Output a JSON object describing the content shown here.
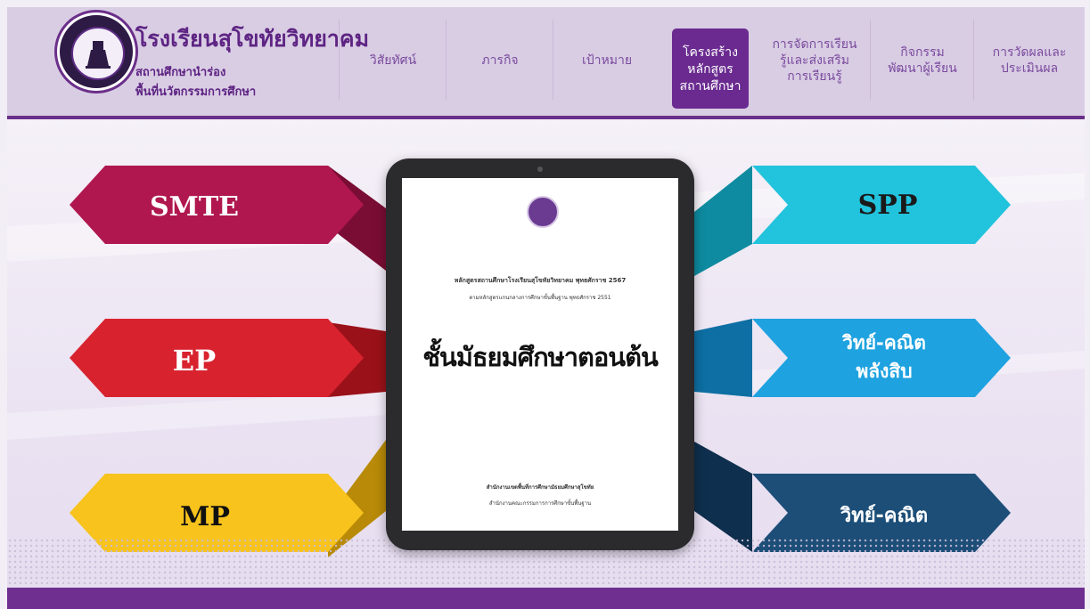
{
  "header": {
    "school_name": "โรงเรียนสุโขทัยวิทยาคม",
    "subtitle1": "สถานศึกษานำร่อง",
    "subtitle2": "พื้นที่นวัตกรรมการศึกษา"
  },
  "nav": {
    "vision": "วิสัยทัศน์",
    "mission": "ภารกิจ",
    "goal": "เป้าหมาย",
    "curriculum": [
      "โครงสร้าง",
      "หลักสูตร",
      "สถานศึกษา"
    ],
    "learning": [
      "การจัดการเรียน",
      "รู้และส่งเสริม",
      "การเรียนรู้"
    ],
    "activities": [
      "กิจกรรม",
      "พัฒนาผู้เรียน"
    ],
    "assessment": [
      "การวัดผลและ",
      "ประเมินผล"
    ]
  },
  "programs": {
    "smte": "SMTE",
    "ep": "EP",
    "mp": "MP",
    "spp": "SPP",
    "sci_math_10": [
      "วิทย์-คณิต",
      "พลังสิบ"
    ],
    "sci_math": "วิทย์-คณิต"
  },
  "document": {
    "line1": "หลักสูตรสถานศึกษาโรงเรียนสุโขทัยวิทยาคม พุทธศักราช 2567",
    "line2": "ตามหลักสูตรแกนกลางการศึกษาขั้นพื้นฐาน พุทธศักราช 2551",
    "title": "ชั้นมัธยมศึกษาตอนต้น",
    "foot1": "สำนักงานเขตพื้นที่การศึกษามัธยมศึกษาสุโขทัย",
    "foot2": "สำนักงานคณะกรรมการการศึกษาขั้นพื้นฐาน"
  },
  "colors": {
    "primary_purple": "#6b2f8a",
    "smte": "#b0174e",
    "ep": "#d8232f",
    "mp": "#f7c31c",
    "spp": "#22c3dc",
    "sci_math_10": "#1fa2e0",
    "sci_math": "#1c4e78"
  }
}
